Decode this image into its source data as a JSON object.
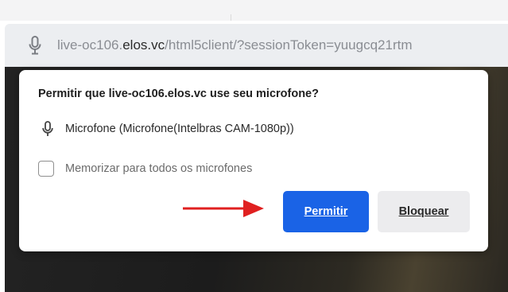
{
  "browser": {
    "address_bar": {
      "url_prefix": "live-oc106.",
      "url_domain": "elos.vc",
      "url_suffix": "/html5client/?sessionToken=yuugcq21rtm"
    }
  },
  "permission_dialog": {
    "title": "Permitir que live-oc106.elos.vc use seu microfone?",
    "device_name": "Microfone (Microfone(Intelbras CAM-1080p))",
    "remember_label": "Memorizar para todos os microfones",
    "remember_checked": false,
    "allow_label": "Permitir",
    "block_label": "Bloquear"
  },
  "colors": {
    "allow_button": "#1a63e6",
    "block_button": "#ececee",
    "annotation_arrow": "#e02020"
  },
  "icons": {
    "address_bar": "microphone-icon",
    "device": "microphone-icon",
    "annotation": "red-arrow"
  }
}
